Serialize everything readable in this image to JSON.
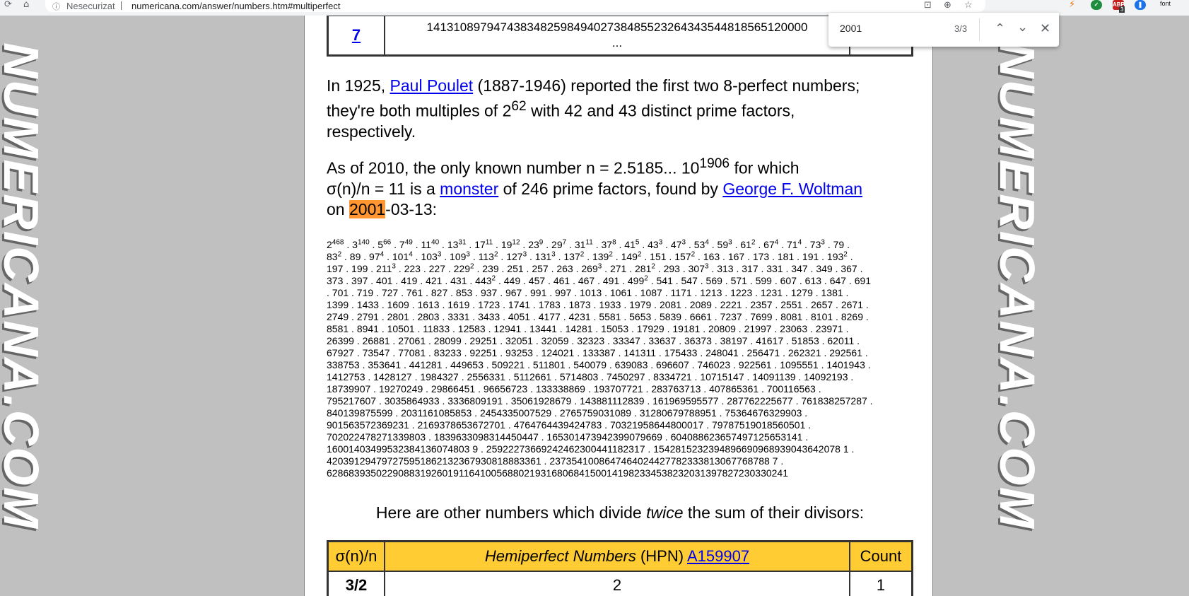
{
  "browser": {
    "security_label": "Nesecurizat",
    "url": "numericana.com/answer/numbers.htm#multiperfect",
    "extension_badge": "3",
    "abp_label": "ABP",
    "font_ext_label": "font"
  },
  "find_bar": {
    "query": "2001",
    "count": "3/3"
  },
  "watermark": "NUMERICANA.COM",
  "top_table": {
    "link": "7",
    "value_line1": "141310897947438348259849402738485523264343544818565120000",
    "value_line2": "..."
  },
  "para1": {
    "prefix": "In 1925, ",
    "link": "Paul Poulet",
    "after_link": " (1887-1946)  reported the first two 8-perfect numbers;",
    "line2_pre": "they're both multiples of  2",
    "line2_sup": "62",
    "line2_post": "  with 42 and 43 distinct prime factors,",
    "line3": "respectively."
  },
  "para2": {
    "line1_pre": "As of 2010, the only known number  n = 2.5185... 10",
    "line1_sup": "1906",
    "line1_post": "  for which",
    "line2_pre": "σ(n)/n = 11  is a ",
    "monster_link": "monster",
    "line2_mid": " of  246  prime factors, found by ",
    "woltman_link": "George F. Woltman",
    "line3_pre": "on ",
    "highlight": "2001",
    "line3_post": "-03-13:"
  },
  "factor_lines": [
    [
      [
        "2",
        "468"
      ],
      [
        " . 3",
        "140"
      ],
      [
        " . 5",
        "66"
      ],
      [
        " . 7",
        "49"
      ],
      [
        " . 11",
        "40"
      ],
      [
        " . 13",
        "31"
      ],
      [
        " . 17",
        "11"
      ],
      [
        " . 19",
        "12"
      ],
      [
        " . 23",
        "9"
      ],
      [
        " . 29",
        "7"
      ],
      [
        " . 31",
        "11"
      ],
      [
        " . 37",
        "8"
      ],
      [
        " . 41",
        "5"
      ],
      [
        " . 43",
        "3"
      ],
      [
        " . 47",
        "3"
      ],
      [
        " . 53",
        "4"
      ],
      [
        " . 59",
        "3"
      ],
      [
        " . 61",
        "2"
      ],
      [
        " . 67",
        "4"
      ],
      [
        " . 71",
        "4"
      ],
      [
        " . 73",
        "3"
      ],
      [
        " . 79 .",
        ""
      ]
    ],
    [
      [
        "83",
        "2"
      ],
      [
        " . 89 . 97",
        "4"
      ],
      [
        " . 101",
        "4"
      ],
      [
        " . 103",
        "3"
      ],
      [
        " . 109",
        "3"
      ],
      [
        " . 113",
        "2"
      ],
      [
        " . 127",
        "3"
      ],
      [
        " . 131",
        "3"
      ],
      [
        " . 137",
        "2"
      ],
      [
        " . 139",
        "2"
      ],
      [
        " . 149",
        "2"
      ],
      [
        " . 151 . 157",
        "2"
      ],
      [
        " . 163 . 167 . 173 . 181 . 191 . 193",
        "2"
      ],
      [
        " .",
        ""
      ]
    ],
    [
      [
        "197 . 199 . 211",
        "3"
      ],
      [
        " . 223 . 227 . 229",
        "2"
      ],
      [
        " . 239 . 251 . 257 . 263 . 269",
        "3"
      ],
      [
        " . 271 . 281",
        "2"
      ],
      [
        " . 293 . 307",
        "3"
      ],
      [
        " . 313 . 317 . 331 . 347 . 349 . 367 .",
        ""
      ]
    ],
    [
      [
        "373 . 397 . 401 . 419 . 421 . 431 . 443",
        "2"
      ],
      [
        " . 449 . 457 . 461 . 467 . 491 . 499",
        "2"
      ],
      [
        " . 541 . 547 . 569 . 571 . 599 . 607 . 613 . 647 . 691",
        ""
      ]
    ],
    [
      [
        " . 701 . 719 . 727 . 761 . 827 . 853 . 937 . 967 . 991 . 997 . 1013 . 1061 . 1087 . 1171 . 1213 . 1223 . 1231 . 1279 . 1381 .",
        ""
      ]
    ],
    [
      [
        "1399 . 1433 . 1609 . 1613 . 1619 . 1723 . 1741 . 1783 . 1873 . 1933 . 1979 . 2081 . 2089 . 2221 . 2357 . 2551 . 2657 . 2671 .",
        ""
      ]
    ],
    [
      [
        "2749 . 2791 . 2801 . 2803 . 3331 . 3433 . 4051 . 4177 . 4231 . 5581 . 5653 . 5839 . 6661 . 7237 . 7699 . 8081 . 8101 . 8269 .",
        ""
      ]
    ],
    [
      [
        "8581 . 8941 . 10501 . 11833 . 12583 . 12941 . 13441 . 14281 . 15053 . 17929 . 19181 . 20809 . 21997 . 23063 . 23971 .",
        ""
      ]
    ],
    [
      [
        "26399 . 26881 . 27061 . 28099 . 29251 . 32051 . 32059 . 32323 . 33347 . 33637 . 36373 . 38197 . 41617 . 51853 . 62011 .",
        ""
      ]
    ],
    [
      [
        "67927 . 73547 . 77081 . 83233 . 92251 . 93253 . 124021 . 133387 . 141311 . 175433 . 248041 . 256471 . 262321 . 292561 .",
        ""
      ]
    ],
    [
      [
        "338753 . 353641 . 441281 . 449653 . 509221 . 511801 . 540079 . 639083 . 696607 . 746023 . 922561 . 1095551 . 1401943 .",
        ""
      ]
    ],
    [
      [
        "1412753 . 1428127 . 1984327 . 2556331 . 5112661 . 5714803 . 7450297 . 8334721 . 10715147 . 14091139 . 14092193 .",
        ""
      ]
    ],
    [
      [
        "18739907 . 19270249 . 29866451 . 96656723 . 133338869 . 193707721 . 283763713 . 407865361 . 700116563 .",
        ""
      ]
    ],
    [
      [
        "795217607 . 3035864933 . 3336809191 . 35061928679 . 143881112839 . 161969595577 . 287762225677 . 761838257287 .",
        ""
      ]
    ],
    [
      [
        "840139875599 . 2031161085853 . 2454335007529 . 2765759031089 . 31280679788951 . 75364676329903 .",
        ""
      ]
    ],
    [
      [
        "901563572369231 . 2169378653672701 . 4764764439424783 . 70321958644800017 . 79787519018560501 .",
        ""
      ]
    ],
    [
      [
        "702022478271339803 . 1839633098314450447 . 165301473942399079669 . 604088623657497125653141 .",
        ""
      ]
    ],
    [
      [
        "16001403499532384136074803 9 . 25922273669242462300441182317 . 1542815232394896690968939043642078 1 .",
        ""
      ]
    ],
    [
      [
        "420391294797275951862132367930818883361 . 2373541008647464024427782333813067768788 7 .",
        ""
      ]
    ],
    [
      [
        "628683935022908831926019116410056880219316806841500141982334538232031397827230330241",
        ""
      ]
    ]
  ],
  "intro2": {
    "pre": "Here are other numbers which divide  ",
    "em": "twice",
    "post": "  the sum of their divisors:"
  },
  "hpn_table": {
    "col1": "σ(n)/n",
    "col2_em": "Hemiperfect Numbers",
    "col2_mid": "  (HPN)  ",
    "col2_link": "A159907",
    "col3": "Count",
    "row1": [
      "3/2",
      "2",
      "1"
    ]
  }
}
